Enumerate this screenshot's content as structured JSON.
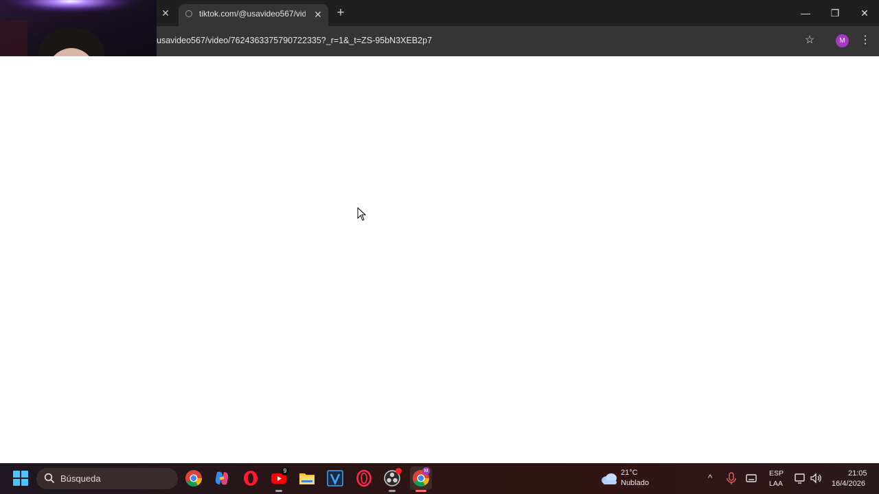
{
  "browser": {
    "tab": {
      "title": "tiktok.com/@usavideo567/vide",
      "close": "✕"
    },
    "previous_tab_close": "✕",
    "new_tab": "+",
    "url": "usavideo567/video/7624363375790722335?_r=1&_t=ZS-95bN3XEB2p7",
    "profile_initial": "M",
    "window_controls": {
      "minimize": "—",
      "restore": "❐",
      "close": "✕"
    }
  },
  "taskbar": {
    "search_placeholder": "Búsqueda",
    "apps": [
      "chrome",
      "copilot",
      "opera",
      "youtube",
      "file-explorer",
      "v-app",
      "opera-gx",
      "obs",
      "chrome-profile"
    ],
    "youtube_badge": "9",
    "weather": {
      "temp": "21°C",
      "desc": "Nublado"
    },
    "language": {
      "line1": "ESP",
      "line2": "LAA"
    },
    "clock": {
      "time": "21:05",
      "date": "16/4/2026"
    }
  },
  "colors": {
    "tabstrip": "#1f1f1f",
    "toolbar": "#353535",
    "accent_profile": "#a23bc2"
  }
}
